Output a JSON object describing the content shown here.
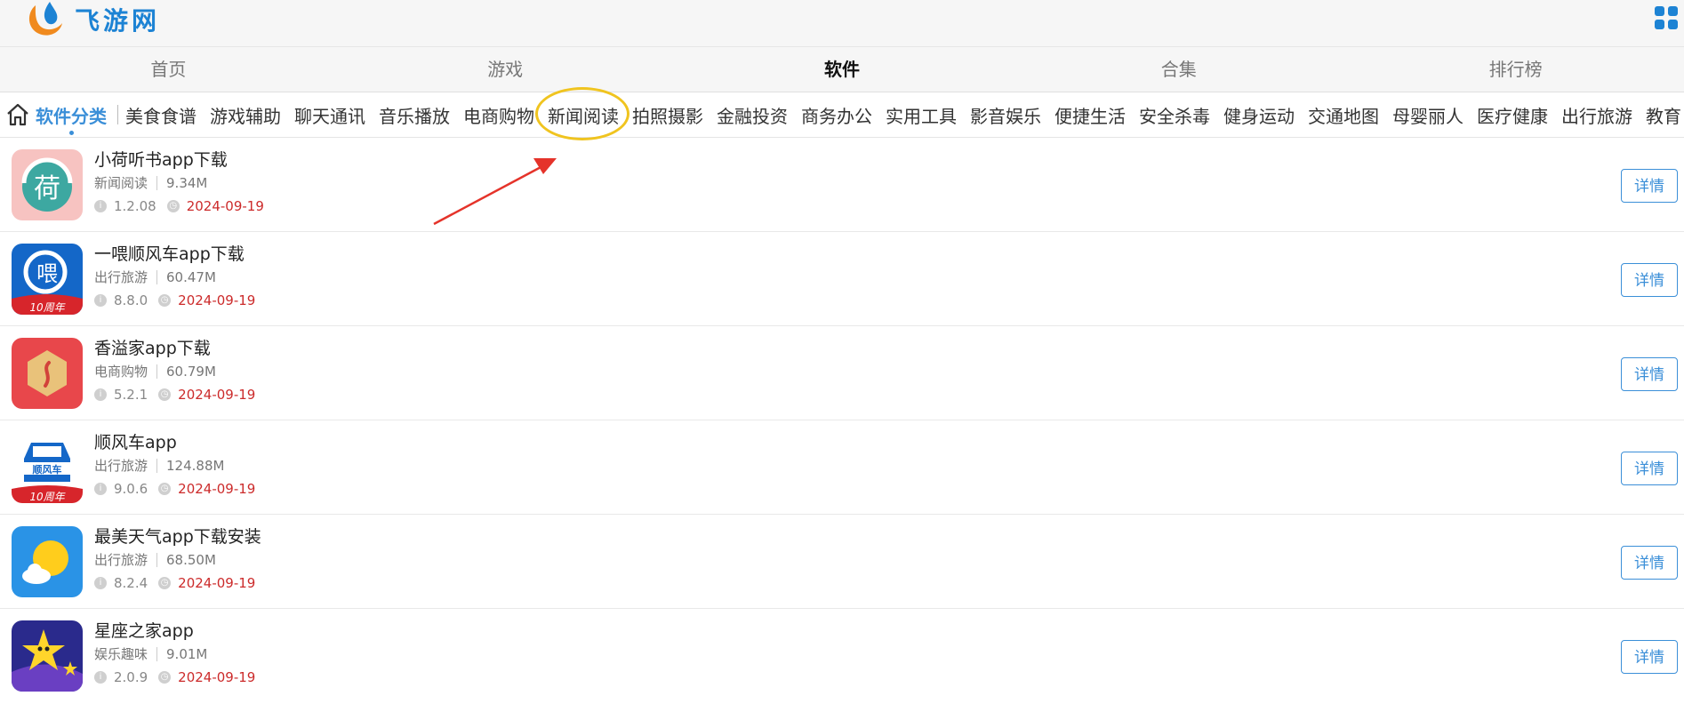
{
  "header": {
    "logo_text": "飞游网",
    "apps_icon": "apps-grid-icon"
  },
  "main_nav": [
    {
      "label": "首页",
      "active": false
    },
    {
      "label": "游戏",
      "active": false
    },
    {
      "label": "软件",
      "active": true
    },
    {
      "label": "合集",
      "active": false
    },
    {
      "label": "排行榜",
      "active": false
    }
  ],
  "category_bar": {
    "home_icon": "home-icon",
    "title": "软件分类",
    "items": [
      "美食食谱",
      "游戏辅助",
      "聊天通讯",
      "音乐播放",
      "电商购物",
      "新闻阅读",
      "拍照摄影",
      "金融投资",
      "商务办公",
      "实用工具",
      "影音娱乐",
      "便捷生活",
      "安全杀毒",
      "健身运动",
      "交通地图",
      "母婴丽人",
      "医疗健康",
      "出行旅游",
      "教育"
    ],
    "highlighted": "新闻阅读"
  },
  "apps": [
    {
      "name": "小荷听书app下载",
      "category": "新闻阅读",
      "size": "9.34M",
      "version": "1.2.08",
      "date": "2024-09-19",
      "detail_label": "详情",
      "icon": "xiaohe-tingshu-icon"
    },
    {
      "name": "一喂顺风车app下载",
      "category": "出行旅游",
      "size": "60.47M",
      "version": "8.8.0",
      "date": "2024-09-19",
      "detail_label": "详情",
      "icon": "yiwei-shunfengche-icon"
    },
    {
      "name": "香溢家app下载",
      "category": "电商购物",
      "size": "60.79M",
      "version": "5.2.1",
      "date": "2024-09-19",
      "detail_label": "详情",
      "icon": "xiangyijia-icon"
    },
    {
      "name": "顺风车app",
      "category": "出行旅游",
      "size": "124.88M",
      "version": "9.0.6",
      "date": "2024-09-19",
      "detail_label": "详情",
      "icon": "shunfengche-icon"
    },
    {
      "name": "最美天气app下载安装",
      "category": "出行旅游",
      "size": "68.50M",
      "version": "8.2.4",
      "date": "2024-09-19",
      "detail_label": "详情",
      "icon": "weather-icon"
    },
    {
      "name": "星座之家app",
      "category": "娱乐趣味",
      "size": "9.01M",
      "version": "2.0.9",
      "date": "2024-09-19",
      "detail_label": "详情",
      "icon": "xingzuo-zhijia-icon"
    }
  ],
  "icon_labels": {
    "tenth_anniversary": "10周年",
    "shunfengche_plate": "顺风车",
    "xiaohe_glyph": "荷",
    "yiwei_glyph": "喂"
  },
  "colors": {
    "accent": "#3b8fd8",
    "date": "#cc2b2b",
    "highlight_ring": "#f0c41f",
    "annotation_arrow": "#e5332a"
  }
}
